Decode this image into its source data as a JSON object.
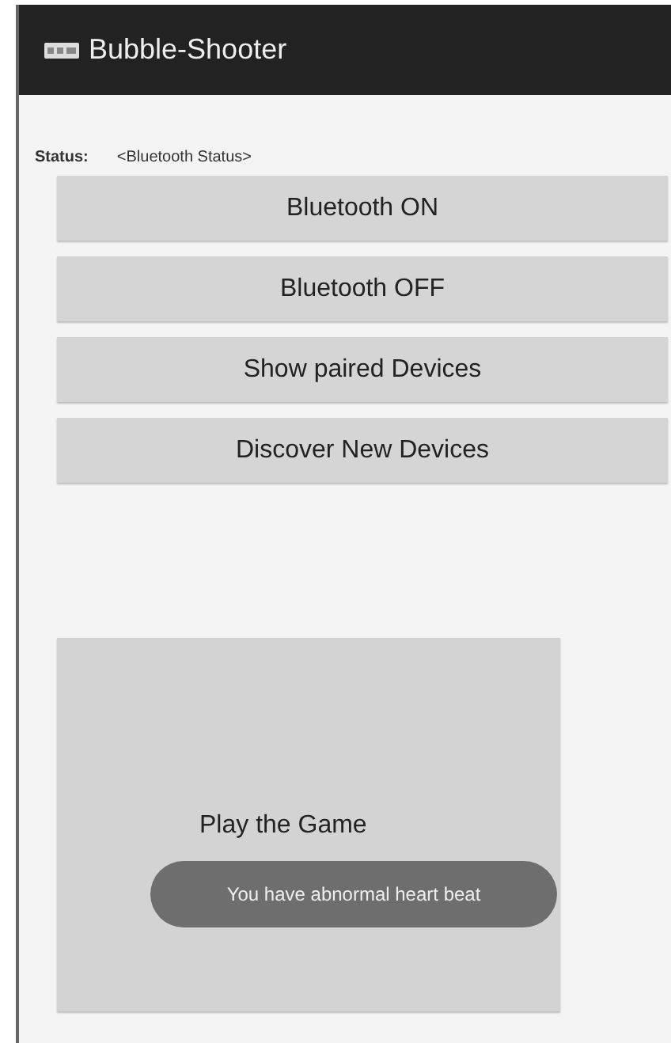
{
  "app_bar": {
    "title": "Bubble-Shooter"
  },
  "status": {
    "label": "Status:",
    "value": "<Bluetooth Status>"
  },
  "buttons": [
    {
      "label": "Bluetooth ON"
    },
    {
      "label": "Bluetooth OFF"
    },
    {
      "label": "Show paired Devices"
    },
    {
      "label": "Discover New Devices"
    }
  ],
  "game_button": {
    "label": "Play the Game"
  },
  "toast": {
    "text": "You have abnormal heart beat"
  }
}
